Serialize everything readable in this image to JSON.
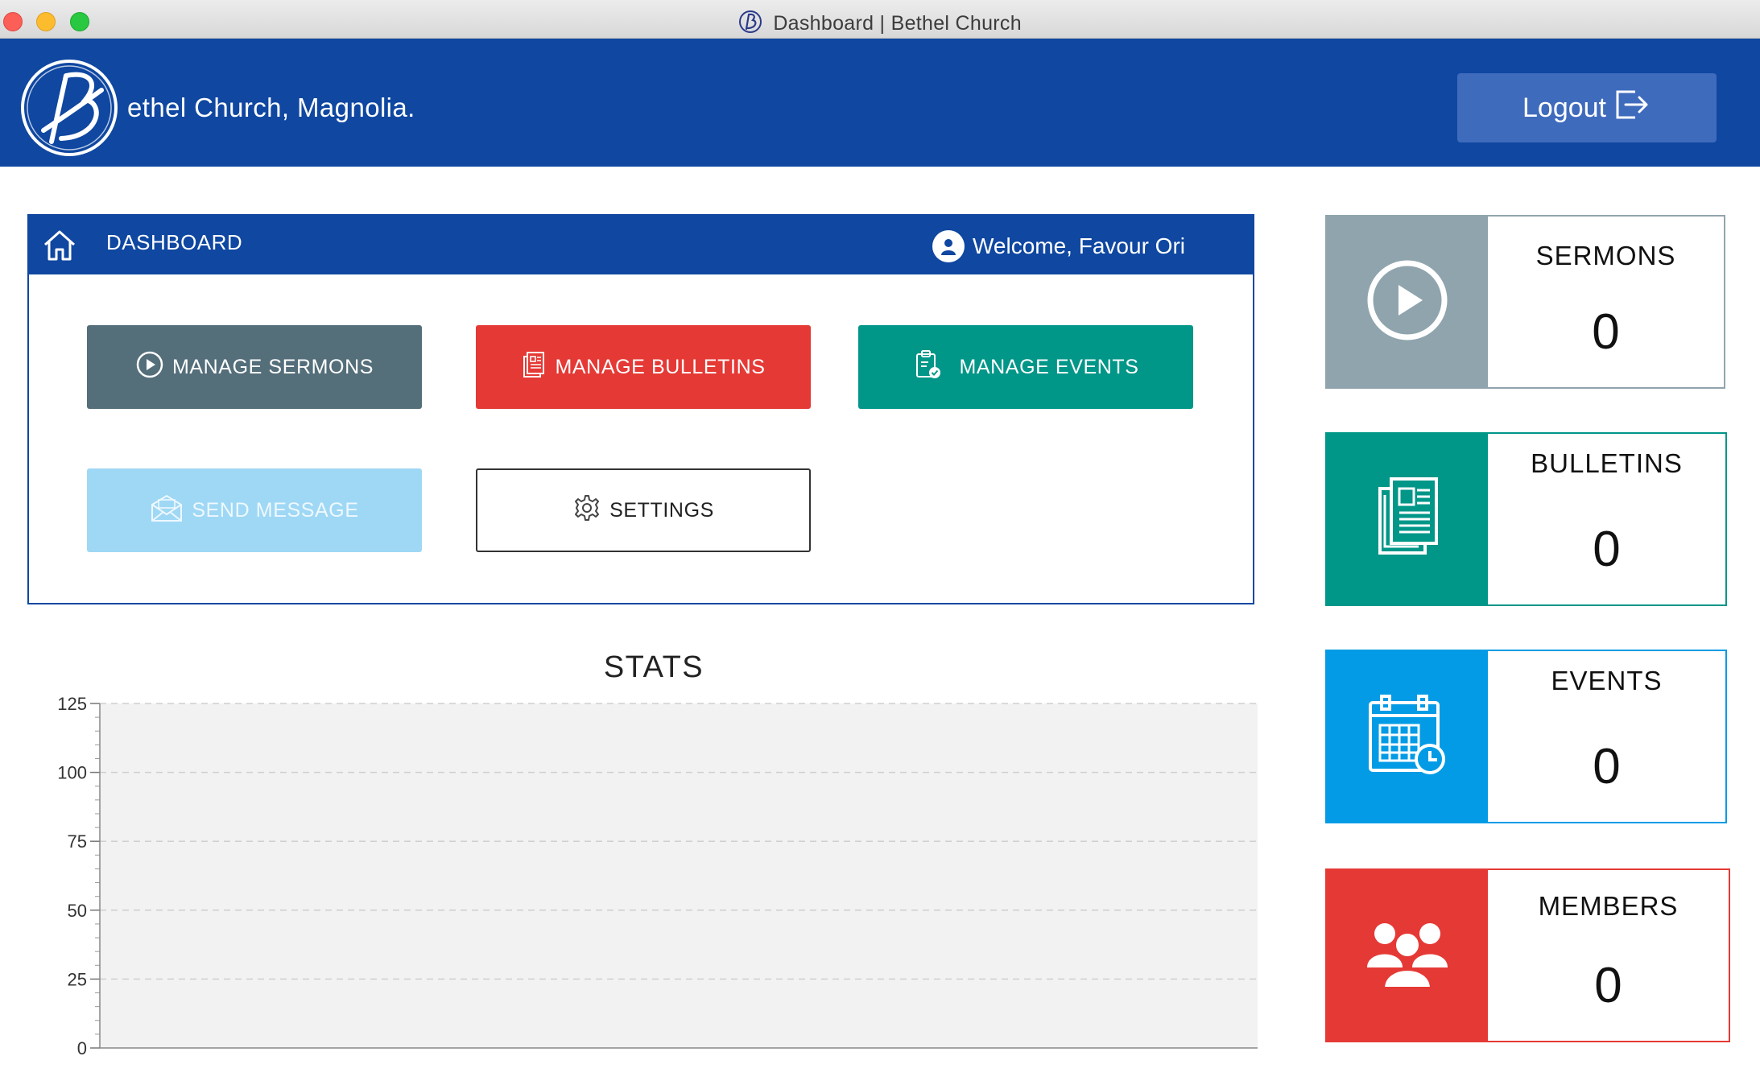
{
  "window": {
    "title": "Dashboard | Bethel Church"
  },
  "header": {
    "brand": "ethel Church, Magnolia.",
    "logout_label": "Logout"
  },
  "dashboard": {
    "title": "DASHBOARD",
    "welcome": "Welcome, Favour Ori",
    "buttons": {
      "sermons": "MANAGE SERMONS",
      "bulletins": "MANAGE BULLETINS",
      "events": "MANAGE EVENTS",
      "message": "SEND MESSAGE",
      "settings": "SETTINGS"
    }
  },
  "stats": {
    "title": "STATS",
    "cards": [
      {
        "label": "SERMONS",
        "value": "0",
        "icon": "play-circle-icon",
        "color": "#90a4ae"
      },
      {
        "label": "BULLETINS",
        "value": "0",
        "icon": "newspaper-icon",
        "color": "#009688"
      },
      {
        "label": "EVENTS",
        "value": "0",
        "icon": "calendar-clock-icon",
        "color": "#039be5"
      },
      {
        "label": "MEMBERS",
        "value": "0",
        "icon": "users-icon",
        "color": "#e53935"
      }
    ]
  },
  "colors": {
    "header": "#0f47a1",
    "logout": "#3f6bbd",
    "sermons": "#546e7a",
    "bulletins": "#e53935",
    "events": "#009688",
    "message": "#9fd8f5"
  },
  "chart_data": {
    "type": "bar",
    "title": "STATS",
    "categories": [],
    "values": [],
    "ylim": [
      0,
      125
    ],
    "yticks": [
      "0",
      "25",
      "50",
      "75",
      "100",
      "125"
    ],
    "grid": true
  }
}
